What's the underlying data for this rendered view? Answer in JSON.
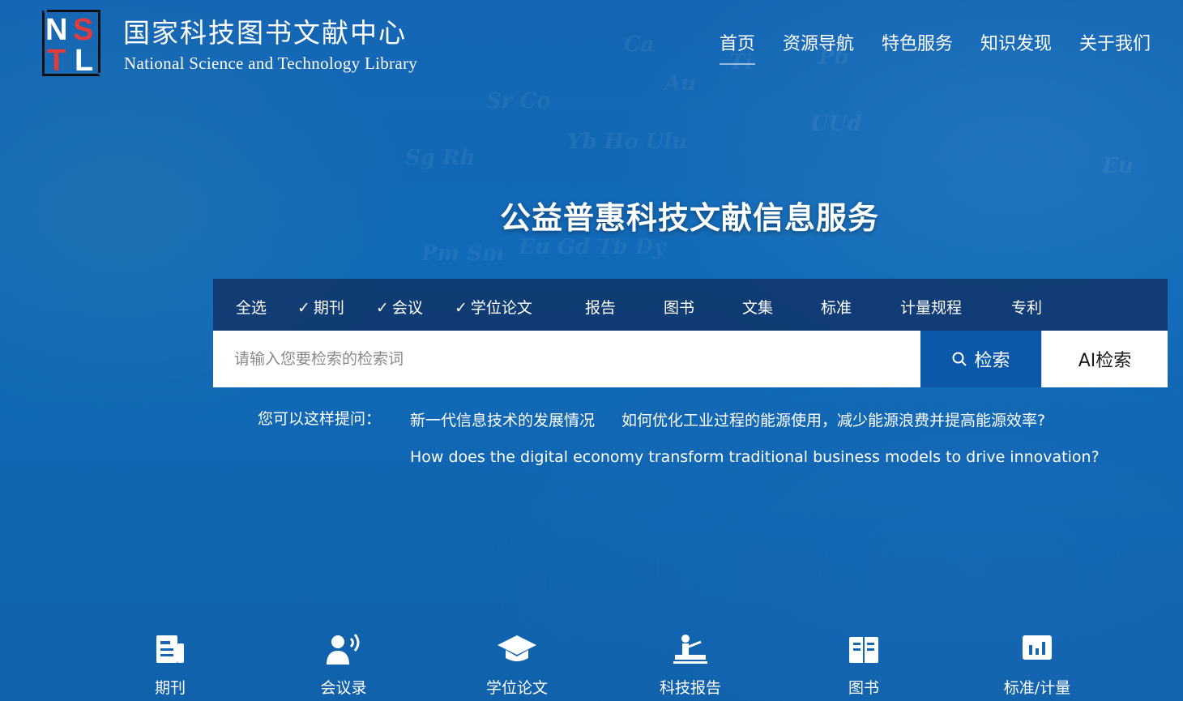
{
  "header": {
    "logo": {
      "letters": [
        "N",
        "S",
        "T",
        "L"
      ]
    },
    "brand_cn": "国家科技图书文献中心",
    "brand_en": "National Science and Technology Library"
  },
  "nav": {
    "items": [
      {
        "label": "首页",
        "active": true
      },
      {
        "label": "资源导航"
      },
      {
        "label": "特色服务"
      },
      {
        "label": "知识发现"
      },
      {
        "label": "关于我们"
      }
    ]
  },
  "hero": {
    "slogan": "公益普惠科技文献信息服务"
  },
  "search": {
    "types": [
      {
        "label": "全选",
        "checked": false
      },
      {
        "label": "期刊",
        "checked": true
      },
      {
        "label": "会议",
        "checked": true
      },
      {
        "label": "学位论文",
        "checked": true
      },
      {
        "label": "报告",
        "checked": false
      },
      {
        "label": "图书",
        "checked": false
      },
      {
        "label": "文集",
        "checked": false
      },
      {
        "label": "标准",
        "checked": false
      },
      {
        "label": "计量规程",
        "checked": false
      },
      {
        "label": "专利",
        "checked": false
      }
    ],
    "check_mark": "✓",
    "placeholder": "请输入您要检索的检索词",
    "search_label": "检索",
    "ai_label": "AI检索"
  },
  "suggestions": {
    "label": "您可以这样提问：",
    "items": [
      "新一代信息技术的发展情况",
      "如何优化工业过程的能源使用，减少能源浪费并提高能源效率?",
      "How does the digital economy transform traditional business models to drive innovation?"
    ]
  },
  "categories": [
    {
      "label": "期刊",
      "icon": "journal-icon"
    },
    {
      "label": "会议录",
      "icon": "speaker-icon"
    },
    {
      "label": "学位论文",
      "icon": "graduation-cap-icon"
    },
    {
      "label": "科技报告",
      "icon": "presentation-icon"
    },
    {
      "label": "图书",
      "icon": "open-book-icon"
    },
    {
      "label": "标准/计量",
      "icon": "bar-chart-icon"
    }
  ]
}
